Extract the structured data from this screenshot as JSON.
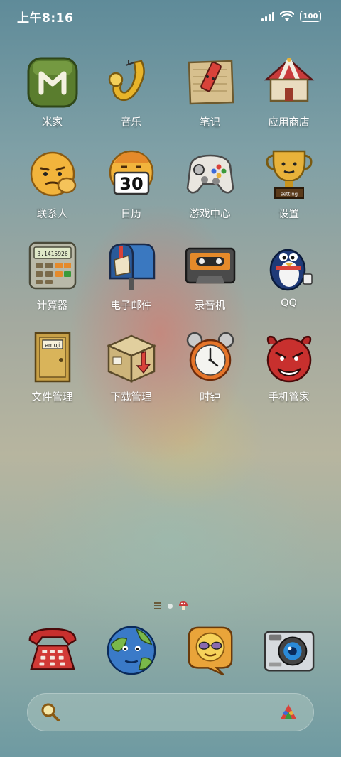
{
  "status_bar": {
    "time": "上午8:16",
    "battery": "100"
  },
  "apps": [
    {
      "label": "米家",
      "icon": "mijia-icon"
    },
    {
      "label": "音乐",
      "icon": "saxophone-icon"
    },
    {
      "label": "笔记",
      "icon": "pencil-note-icon"
    },
    {
      "label": "应用商店",
      "icon": "circus-tent-icon"
    },
    {
      "label": "联系人",
      "icon": "thinking-face-icon"
    },
    {
      "label": "日历",
      "icon": "calendar-face-icon",
      "badge": "30"
    },
    {
      "label": "游戏中心",
      "icon": "gamepad-icon"
    },
    {
      "label": "设置",
      "icon": "trophy-icon",
      "badge": "setting"
    },
    {
      "label": "计算器",
      "icon": "calculator-icon",
      "badge": "3.1415926"
    },
    {
      "label": "电子邮件",
      "icon": "mailbox-icon"
    },
    {
      "label": "录音机",
      "icon": "cassette-icon"
    },
    {
      "label": "QQ",
      "icon": "penguin-icon"
    },
    {
      "label": "文件管理",
      "icon": "door-icon",
      "badge": "emoji"
    },
    {
      "label": "下载管理",
      "icon": "box-icon"
    },
    {
      "label": "时钟",
      "icon": "alarm-clock-icon"
    },
    {
      "label": "手机管家",
      "icon": "devil-face-icon"
    }
  ],
  "dock": [
    {
      "icon": "telephone-icon"
    },
    {
      "icon": "earth-icon"
    },
    {
      "icon": "sunglasses-chat-icon"
    },
    {
      "icon": "camera-icon"
    }
  ],
  "colors": {
    "accent": "#e8b23a"
  }
}
